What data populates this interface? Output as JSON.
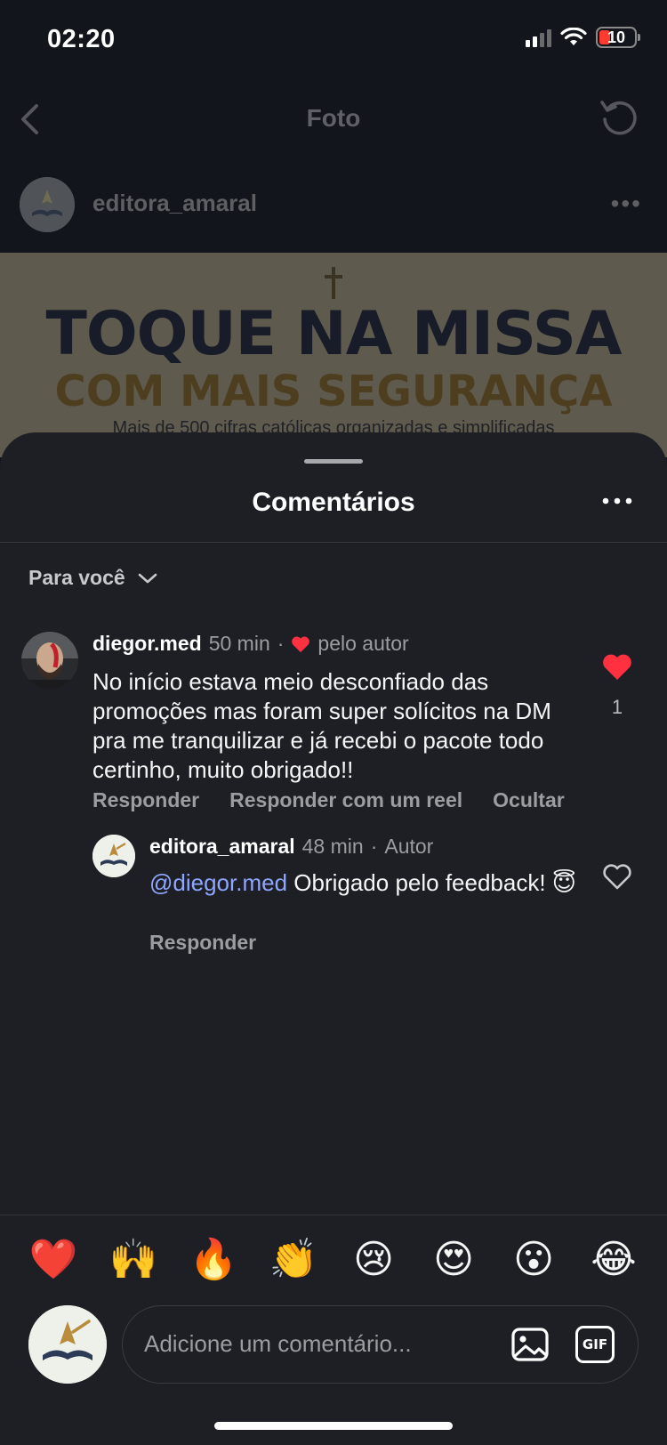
{
  "status_bar": {
    "time": "02:20",
    "battery": "10"
  },
  "header": {
    "title": "Foto"
  },
  "post": {
    "username": "editora_amaral",
    "more": "•••",
    "image_headline": "TOQUE NA MISSA",
    "image_subheadline": "COM MAIS SEGURANÇA",
    "image_caption": "Mais de 500 cifras católicas organizadas e simplificadas"
  },
  "sheet": {
    "title": "Comentários",
    "filter_label": "Para você"
  },
  "comments": [
    {
      "username": "diegor.med",
      "time": "50 min",
      "sep": "·",
      "liked_by_label": "pelo autor",
      "text": "No início estava meio desconfiado das promoções mas foram super solícitos na DM pra me tranquilizar e já recebi o pacote todo certinho, muito obrigado!!",
      "like_count": "1",
      "liked": true,
      "actions": {
        "reply": "Responder",
        "reply_reel": "Responder com um reel",
        "hide": "Ocultar"
      },
      "replies": [
        {
          "username": "editora_amaral",
          "time": "48 min",
          "sep": "·",
          "badge": "Autor",
          "mention": "@diegor.med",
          "text": " Obrigado pelo feedback! 😇",
          "liked": false,
          "actions": {
            "reply": "Responder"
          }
        }
      ]
    }
  ],
  "emoji_bar": [
    "❤️",
    "🙌",
    "🔥",
    "👏",
    "😢",
    "😍",
    "😮",
    "😂"
  ],
  "composer": {
    "placeholder": "Adicione um comentário...",
    "gif_label": "GIF"
  },
  "colors": {
    "background": "#1d1f24",
    "like_red": "#ff3040",
    "mention": "#8ea6ff",
    "muted": "#9b9da1"
  }
}
